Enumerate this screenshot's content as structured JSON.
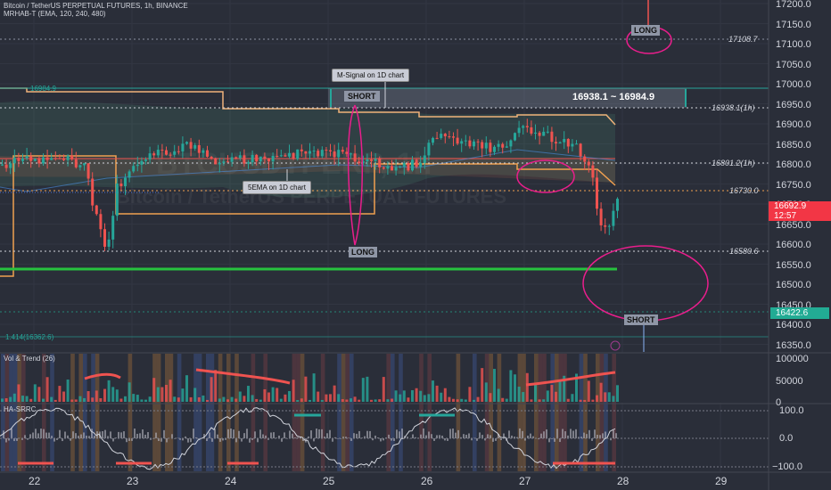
{
  "header": {
    "symbol_title": "Bitcoin / TetherUS PERPETUAL FUTURES, 1h, BINANCE",
    "indicator": "MRHAB-T (EMA, 120, 240, 480)"
  },
  "watermark": {
    "ticker": "BTCUSDTPERP, 1h",
    "name": "Bitcoin / TetherUS PERPETUAL FUTURES"
  },
  "price_axis": {
    "ticks": [
      "17200.0",
      "17150.0",
      "17100.0",
      "17050.0",
      "17000.0",
      "16950.0",
      "16900.0",
      "16850.0",
      "16800.0",
      "16750.0",
      "16700.0",
      "16650.0",
      "16600.0",
      "16550.0",
      "16500.0",
      "16450.0",
      "16400.0",
      "16350.0"
    ],
    "current_price": "16692.9",
    "countdown": "12:57",
    "green_tag": "16422.6"
  },
  "levels": {
    "l17108": "17108.7",
    "l16938": "16938.1(1h)",
    "l16801": "16801.2(1h)",
    "l16730": "16730.0",
    "l16580": "16580.6",
    "l16984": "16984.9",
    "fib": "1.414(16362.6)"
  },
  "annotations": {
    "short_box": "SHORT",
    "range_label": "16938.1 ~ 16984.9",
    "msignal": "M-Signal on 1D chart",
    "ema5": "5EMA on 1D chart",
    "long_mid": "LONG",
    "long_top": "LONG",
    "short_bottom": "SHORT"
  },
  "volume_pane": {
    "title": "Vol & Trend (26)",
    "ticks": [
      "100000",
      "50000",
      "0"
    ]
  },
  "osc_pane": {
    "title": "HA-SRRC",
    "ticks": [
      "100.0",
      "0.0",
      "−100.0"
    ]
  },
  "time_axis": {
    "labels": [
      "22",
      "23",
      "24",
      "25",
      "26",
      "27",
      "28",
      "29"
    ]
  },
  "colors": {
    "background": "#2a2e39",
    "bull": "#26a69a",
    "bear": "#ef5350",
    "magenta": "#e91e8c",
    "ema_orange": "#f0a050",
    "price_tag": "#f23645",
    "green_tag": "#22ab94"
  }
}
